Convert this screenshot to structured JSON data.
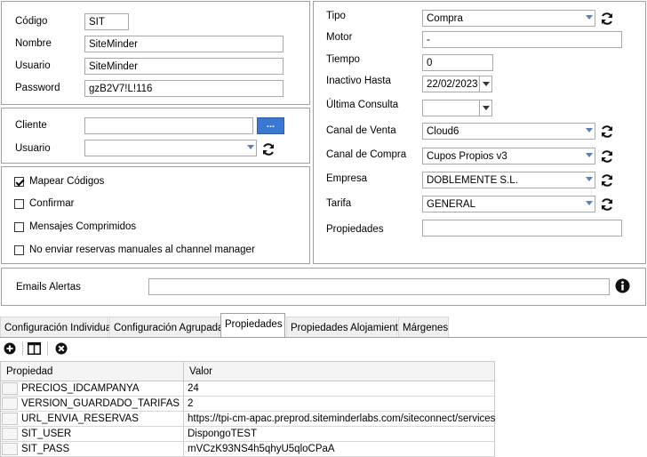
{
  "account": {
    "codigo_label": "Código",
    "codigo_value": "SIT",
    "nombre_label": "Nombre",
    "nombre_value": "SiteMinder",
    "usuario_label": "Usuario",
    "usuario_value": "SiteMinder",
    "password_label": "Password",
    "password_value": "gzB2V7!L!116"
  },
  "client": {
    "cliente_label": "Cliente",
    "cliente_value": "",
    "browse_label": "...",
    "usuario_label": "Usuario",
    "usuario_value": ""
  },
  "options": {
    "mapear_label": "Mapear Códigos",
    "mapear_checked": true,
    "confirmar_label": "Confirmar",
    "confirmar_checked": false,
    "mensajes_label": "Mensajes Comprimidos",
    "mensajes_checked": false,
    "no_enviar_label": "No enviar reservas manuales al channel manager",
    "no_enviar_checked": false
  },
  "settings": {
    "tipo_label": "Tipo",
    "tipo_value": "Compra",
    "motor_label": "Motor",
    "motor_value": "-",
    "tiempo_label": "Tiempo",
    "tiempo_value": "0",
    "inactivo_label": "Inactivo Hasta",
    "inactivo_value": "22/02/2023",
    "ultima_label": "Última Consulta",
    "ultima_value": "",
    "canal_venta_label": "Canal de Venta",
    "canal_venta_value": "Cloud6",
    "canal_compra_label": "Canal de Compra",
    "canal_compra_value": "Cupos Propios v3",
    "empresa_label": "Empresa",
    "empresa_value": "DOBLEMENTE S.L.",
    "tarifa_label": "Tarifa",
    "tarifa_value": "GENERAL",
    "propiedades_label": "Propiedades",
    "propiedades_value": ""
  },
  "emails": {
    "label": "Emails Alertas",
    "value": ""
  },
  "tabs": [
    {
      "label": "Configuración Individual"
    },
    {
      "label": "Configuración Agrupada"
    },
    {
      "label": "Propiedades",
      "active": true
    },
    {
      "label": "Propiedades Alojamiento"
    },
    {
      "label": "Márgenes"
    }
  ],
  "toolbar": {
    "icons": [
      "add-icon",
      "columns-icon",
      "delete-icon"
    ]
  },
  "grid": {
    "headers": {
      "propiedad": "Propiedad",
      "valor": "Valor"
    },
    "rows": [
      {
        "propiedad": "PRECIOS_IDCAMPANYA",
        "valor": "24"
      },
      {
        "propiedad": "VERSION_GUARDADO_TARIFAS",
        "valor": "2"
      },
      {
        "propiedad": "URL_ENVIA_RESERVAS",
        "valor": "https://tpi-cm-apac.preprod.siteminderlabs.com/siteconnect/services"
      },
      {
        "propiedad": "SIT_USER",
        "valor": "DispongoTEST"
      },
      {
        "propiedad": "SIT_PASS",
        "valor": "mVCzK93NS4h5qhyU5qloCPaA"
      }
    ]
  }
}
